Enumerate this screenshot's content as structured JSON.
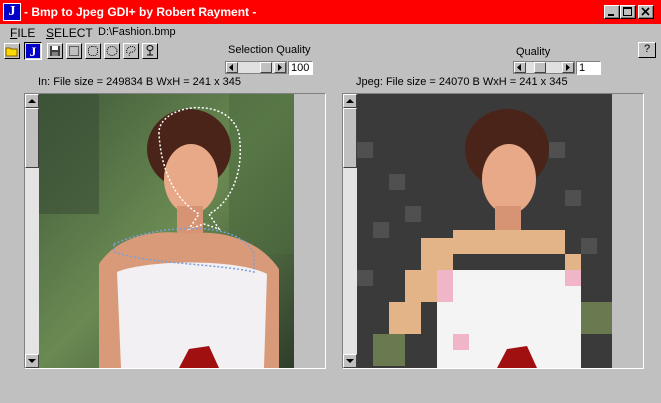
{
  "window": {
    "title": " - Bmp to Jpeg GDI+  by Robert Rayment -",
    "app_icon_letter": "J"
  },
  "menu": {
    "file_first": "F",
    "file_rest": "ILE",
    "select_first": "S",
    "select_rest": "ELECT",
    "path": "D:\\Fashion.bmp"
  },
  "selection_quality": {
    "label": "Selection Quality",
    "value": "100"
  },
  "quality": {
    "label": "Quality",
    "value": "1"
  },
  "help": {
    "label": "?"
  },
  "left_info": "In: File size = 249834 B  WxH =  241 x 345",
  "right_info": "Jpeg: File size = 24070 B  WxH =  241 x 345",
  "icons": [
    "open-icon",
    "jpeg-icon",
    "save-icon",
    "rect-select-icon",
    "rounded-select-icon",
    "ellipse-select-icon",
    "lasso-icon",
    "clear-select-icon"
  ],
  "colors": {
    "titlebar": "#ff0000",
    "face": "#c0c0c0",
    "icon_blue": "#0000c8"
  }
}
